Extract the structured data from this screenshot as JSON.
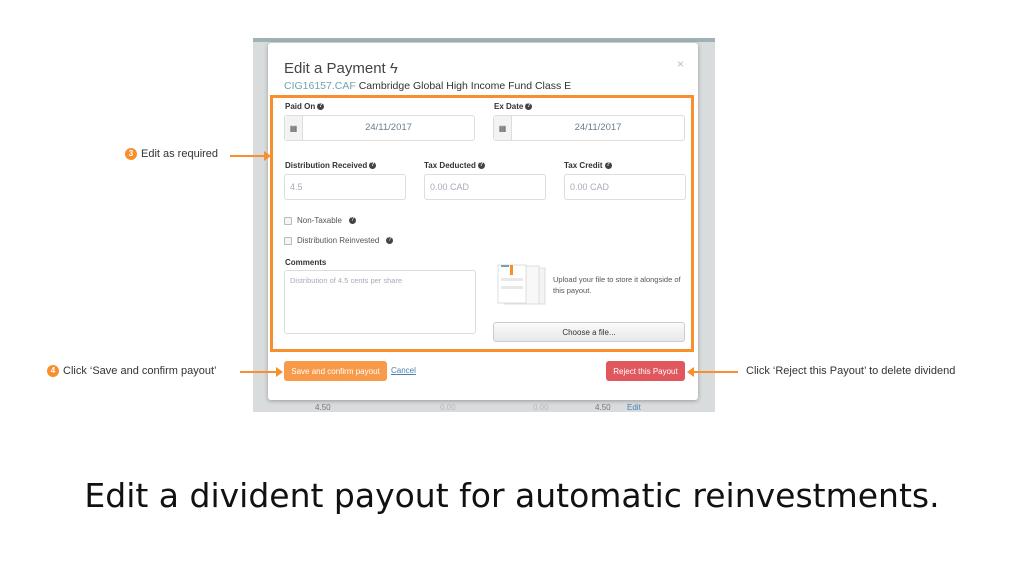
{
  "modal": {
    "title": "Edit a Payment",
    "close": "×",
    "fund_code": "CIG16157.CAF",
    "fund_name": "Cambridge Global High Income Fund Class E"
  },
  "fields": {
    "paid_on": {
      "label": "Paid On",
      "value": "24/11/2017"
    },
    "ex_date": {
      "label": "Ex Date",
      "value": "24/11/2017"
    },
    "distribution_received": {
      "label": "Distribution Received",
      "value": "4.5"
    },
    "tax_deducted": {
      "label": "Tax Deducted",
      "placeholder": "0.00 CAD"
    },
    "tax_credit": {
      "label": "Tax Credit",
      "placeholder": "0.00 CAD"
    },
    "non_taxable": {
      "label": "Non-Taxable",
      "checked": false
    },
    "distribution_reinvested": {
      "label": "Distribution Reinvested",
      "checked": false
    },
    "comments": {
      "label": "Comments",
      "value": "Distribution of 4.5 cents per share"
    }
  },
  "upload": {
    "text": "Upload your file to store it alongside of this payout.",
    "button": "Choose a file..."
  },
  "actions": {
    "save": "Save and confirm payout",
    "cancel": "Cancel",
    "reject": "Reject this Payout"
  },
  "background_row": {
    "c1": "4.50",
    "c2": "0.00",
    "c3": "0.00",
    "c4": "4.50",
    "edit": "Edit"
  },
  "annotations": {
    "step3": {
      "num": "3",
      "text": "Edit as required"
    },
    "step4": {
      "num": "4",
      "text": "Click ‘Save and confirm payout’"
    },
    "reject": {
      "text": "Click ‘Reject this Payout’ to delete dividend"
    }
  },
  "caption": "Edit a divident payout for automatic reinvestments.",
  "colors": {
    "accent": "#f7902c",
    "save": "#f79a4a",
    "reject": "#e0585e"
  }
}
